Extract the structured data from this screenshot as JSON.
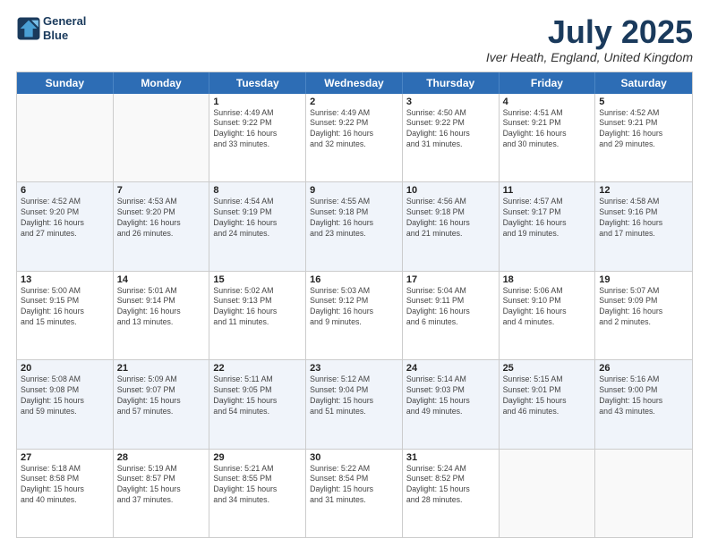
{
  "header": {
    "logo_line1": "General",
    "logo_line2": "Blue",
    "title": "July 2025",
    "location": "Iver Heath, England, United Kingdom"
  },
  "weekdays": [
    "Sunday",
    "Monday",
    "Tuesday",
    "Wednesday",
    "Thursday",
    "Friday",
    "Saturday"
  ],
  "rows": [
    [
      {
        "day": "",
        "info": ""
      },
      {
        "day": "",
        "info": ""
      },
      {
        "day": "1",
        "info": "Sunrise: 4:49 AM\nSunset: 9:22 PM\nDaylight: 16 hours\nand 33 minutes."
      },
      {
        "day": "2",
        "info": "Sunrise: 4:49 AM\nSunset: 9:22 PM\nDaylight: 16 hours\nand 32 minutes."
      },
      {
        "day": "3",
        "info": "Sunrise: 4:50 AM\nSunset: 9:22 PM\nDaylight: 16 hours\nand 31 minutes."
      },
      {
        "day": "4",
        "info": "Sunrise: 4:51 AM\nSunset: 9:21 PM\nDaylight: 16 hours\nand 30 minutes."
      },
      {
        "day": "5",
        "info": "Sunrise: 4:52 AM\nSunset: 9:21 PM\nDaylight: 16 hours\nand 29 minutes."
      }
    ],
    [
      {
        "day": "6",
        "info": "Sunrise: 4:52 AM\nSunset: 9:20 PM\nDaylight: 16 hours\nand 27 minutes."
      },
      {
        "day": "7",
        "info": "Sunrise: 4:53 AM\nSunset: 9:20 PM\nDaylight: 16 hours\nand 26 minutes."
      },
      {
        "day": "8",
        "info": "Sunrise: 4:54 AM\nSunset: 9:19 PM\nDaylight: 16 hours\nand 24 minutes."
      },
      {
        "day": "9",
        "info": "Sunrise: 4:55 AM\nSunset: 9:18 PM\nDaylight: 16 hours\nand 23 minutes."
      },
      {
        "day": "10",
        "info": "Sunrise: 4:56 AM\nSunset: 9:18 PM\nDaylight: 16 hours\nand 21 minutes."
      },
      {
        "day": "11",
        "info": "Sunrise: 4:57 AM\nSunset: 9:17 PM\nDaylight: 16 hours\nand 19 minutes."
      },
      {
        "day": "12",
        "info": "Sunrise: 4:58 AM\nSunset: 9:16 PM\nDaylight: 16 hours\nand 17 minutes."
      }
    ],
    [
      {
        "day": "13",
        "info": "Sunrise: 5:00 AM\nSunset: 9:15 PM\nDaylight: 16 hours\nand 15 minutes."
      },
      {
        "day": "14",
        "info": "Sunrise: 5:01 AM\nSunset: 9:14 PM\nDaylight: 16 hours\nand 13 minutes."
      },
      {
        "day": "15",
        "info": "Sunrise: 5:02 AM\nSunset: 9:13 PM\nDaylight: 16 hours\nand 11 minutes."
      },
      {
        "day": "16",
        "info": "Sunrise: 5:03 AM\nSunset: 9:12 PM\nDaylight: 16 hours\nand 9 minutes."
      },
      {
        "day": "17",
        "info": "Sunrise: 5:04 AM\nSunset: 9:11 PM\nDaylight: 16 hours\nand 6 minutes."
      },
      {
        "day": "18",
        "info": "Sunrise: 5:06 AM\nSunset: 9:10 PM\nDaylight: 16 hours\nand 4 minutes."
      },
      {
        "day": "19",
        "info": "Sunrise: 5:07 AM\nSunset: 9:09 PM\nDaylight: 16 hours\nand 2 minutes."
      }
    ],
    [
      {
        "day": "20",
        "info": "Sunrise: 5:08 AM\nSunset: 9:08 PM\nDaylight: 15 hours\nand 59 minutes."
      },
      {
        "day": "21",
        "info": "Sunrise: 5:09 AM\nSunset: 9:07 PM\nDaylight: 15 hours\nand 57 minutes."
      },
      {
        "day": "22",
        "info": "Sunrise: 5:11 AM\nSunset: 9:05 PM\nDaylight: 15 hours\nand 54 minutes."
      },
      {
        "day": "23",
        "info": "Sunrise: 5:12 AM\nSunset: 9:04 PM\nDaylight: 15 hours\nand 51 minutes."
      },
      {
        "day": "24",
        "info": "Sunrise: 5:14 AM\nSunset: 9:03 PM\nDaylight: 15 hours\nand 49 minutes."
      },
      {
        "day": "25",
        "info": "Sunrise: 5:15 AM\nSunset: 9:01 PM\nDaylight: 15 hours\nand 46 minutes."
      },
      {
        "day": "26",
        "info": "Sunrise: 5:16 AM\nSunset: 9:00 PM\nDaylight: 15 hours\nand 43 minutes."
      }
    ],
    [
      {
        "day": "27",
        "info": "Sunrise: 5:18 AM\nSunset: 8:58 PM\nDaylight: 15 hours\nand 40 minutes."
      },
      {
        "day": "28",
        "info": "Sunrise: 5:19 AM\nSunset: 8:57 PM\nDaylight: 15 hours\nand 37 minutes."
      },
      {
        "day": "29",
        "info": "Sunrise: 5:21 AM\nSunset: 8:55 PM\nDaylight: 15 hours\nand 34 minutes."
      },
      {
        "day": "30",
        "info": "Sunrise: 5:22 AM\nSunset: 8:54 PM\nDaylight: 15 hours\nand 31 minutes."
      },
      {
        "day": "31",
        "info": "Sunrise: 5:24 AM\nSunset: 8:52 PM\nDaylight: 15 hours\nand 28 minutes."
      },
      {
        "day": "",
        "info": ""
      },
      {
        "day": "",
        "info": ""
      }
    ]
  ]
}
